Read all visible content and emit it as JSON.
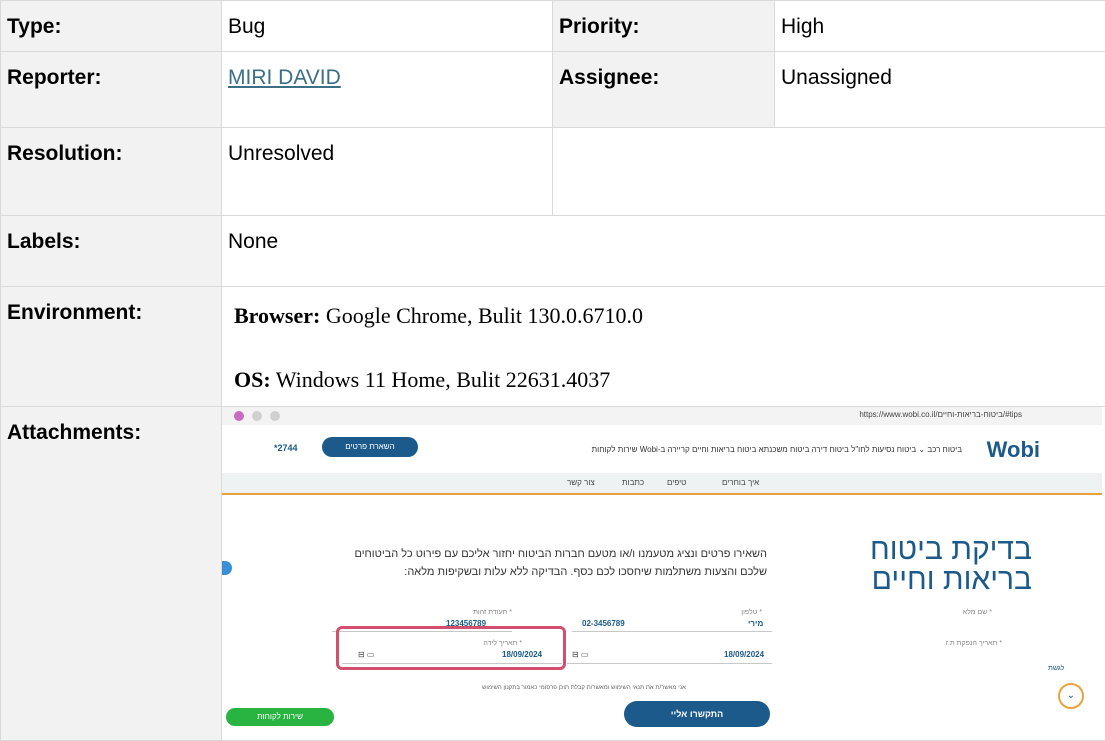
{
  "rows": {
    "type": {
      "label": "Type:",
      "value": "Bug"
    },
    "priority": {
      "label": "Priority:",
      "value": "High"
    },
    "reporter": {
      "label": "Reporter:",
      "value": "MIRI DAVID"
    },
    "assignee": {
      "label": "Assignee:",
      "value": "Unassigned"
    },
    "resolution": {
      "label": "Resolution:",
      "value": "Unresolved"
    },
    "labels": {
      "label": "Labels:",
      "value": "None"
    },
    "environment": {
      "label": "Environment:",
      "browser_label": "Browser:",
      "browser_value": "Google Chrome, Bulit 130.0.6710.0",
      "os_label": "OS:",
      "os_value": "Windows 11 Home, Bulit 22631.4037"
    },
    "attachments": {
      "label": "Attachments:"
    }
  },
  "screenshot": {
    "url": "https://www.wobi.co.il/ביטוח-בריאות-וחיים/#tips",
    "logo": "Wobi",
    "nav_links": "ביטוח רכב ⌄  ביטוח נסיעות לחו\"ל  ביטוח דירה  ביטוח משכנתא  ביטוח בריאות וחיים  קריירה ב-Wobi  שירות לקוחות",
    "leave_details": "השארת פרטים",
    "phone": "*2744",
    "subnav": [
      "איך בוחרים",
      "טיפים",
      "כתבות",
      "צור קשר"
    ],
    "heading": "בדיקת ביטוח בריאות וחיים",
    "paragraph": "השאירו פרטים ונציג מטעמנו ו/או מטעם חברות הביטוח יחזור אליכם עם פירוט כל הביטוחים שלכם והצעות משתלמות שיחסכו לכם כסף. הבדיקה ללא עלות ובשקיפות מלאה:",
    "fields": {
      "full_name_label": "* שם מלא",
      "full_name_value": "מירי",
      "phone_label": "* טלפון",
      "phone_value": "02-3456789",
      "id_label": "* תעודת זהות",
      "id_value": "123456789",
      "issue_date_label": "* תאריך הנפקת ת.ז",
      "issue_date_value": "18/09/2024",
      "birth_date_label": "* תאריך לידה",
      "birth_date_value": "18/09/2024"
    },
    "consent": "אני מאשר/ת את תנאי השימוש ומאשר/ת קבלת תוכן פרסומי כאמור בתקנון השימוש",
    "contact_button": "התקשרו אליי",
    "whatsapp_button": "שירות לקוחות",
    "side_label": "לגשת"
  },
  "colors": {
    "label_bg": "#f2f2f2",
    "link": "#3b6f86",
    "wobi_blue": "#1b5a8a",
    "highlight": "#d2506e",
    "accent": "#e8a33d"
  }
}
